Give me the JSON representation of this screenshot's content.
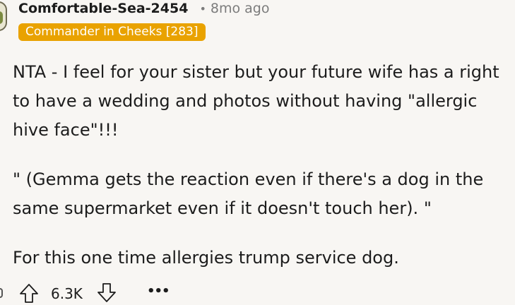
{
  "comment": {
    "author": "Comfortable-Sea-2454",
    "separator": "•",
    "age": "8mo ago",
    "flair": "Commander in Cheeks [283]",
    "flair_color": "#e9a200",
    "paragraphs": [
      "NTA - I feel for your sister but your future wife has a right to have a wedding and photos without having \"allergic hive face\"!!!",
      "\" (Gemma gets the reaction even if there's a dog in the same supermarket even if it doesn't touch her). \"",
      "For this one time allergies trump service dog."
    ]
  },
  "actions": {
    "upvote_icon": "arrow-up-icon",
    "score": "6.3K",
    "downvote_icon": "arrow-down-icon",
    "more_label": "•••"
  }
}
